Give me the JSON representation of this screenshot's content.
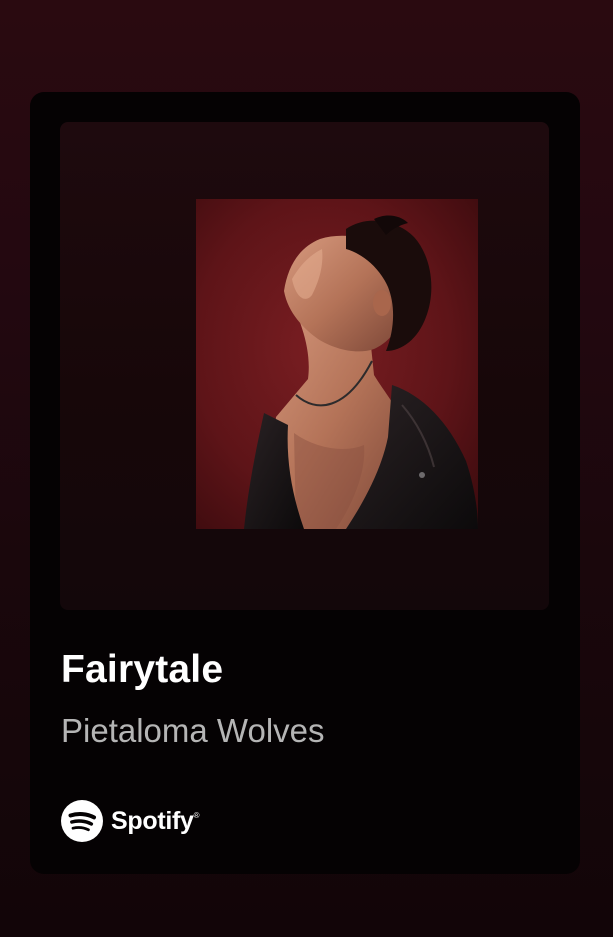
{
  "track": {
    "title": "Fairytale",
    "artist": "Pietaloma Wolves",
    "cover_art": "album-cover-image"
  },
  "brand": {
    "name": "Spotify",
    "trademark": "®",
    "icon": "spotify-logo-icon"
  },
  "colors": {
    "background_top": "#2a0a10",
    "card": "#050203",
    "title": "#ffffff",
    "artist": "#b5b5b5"
  }
}
